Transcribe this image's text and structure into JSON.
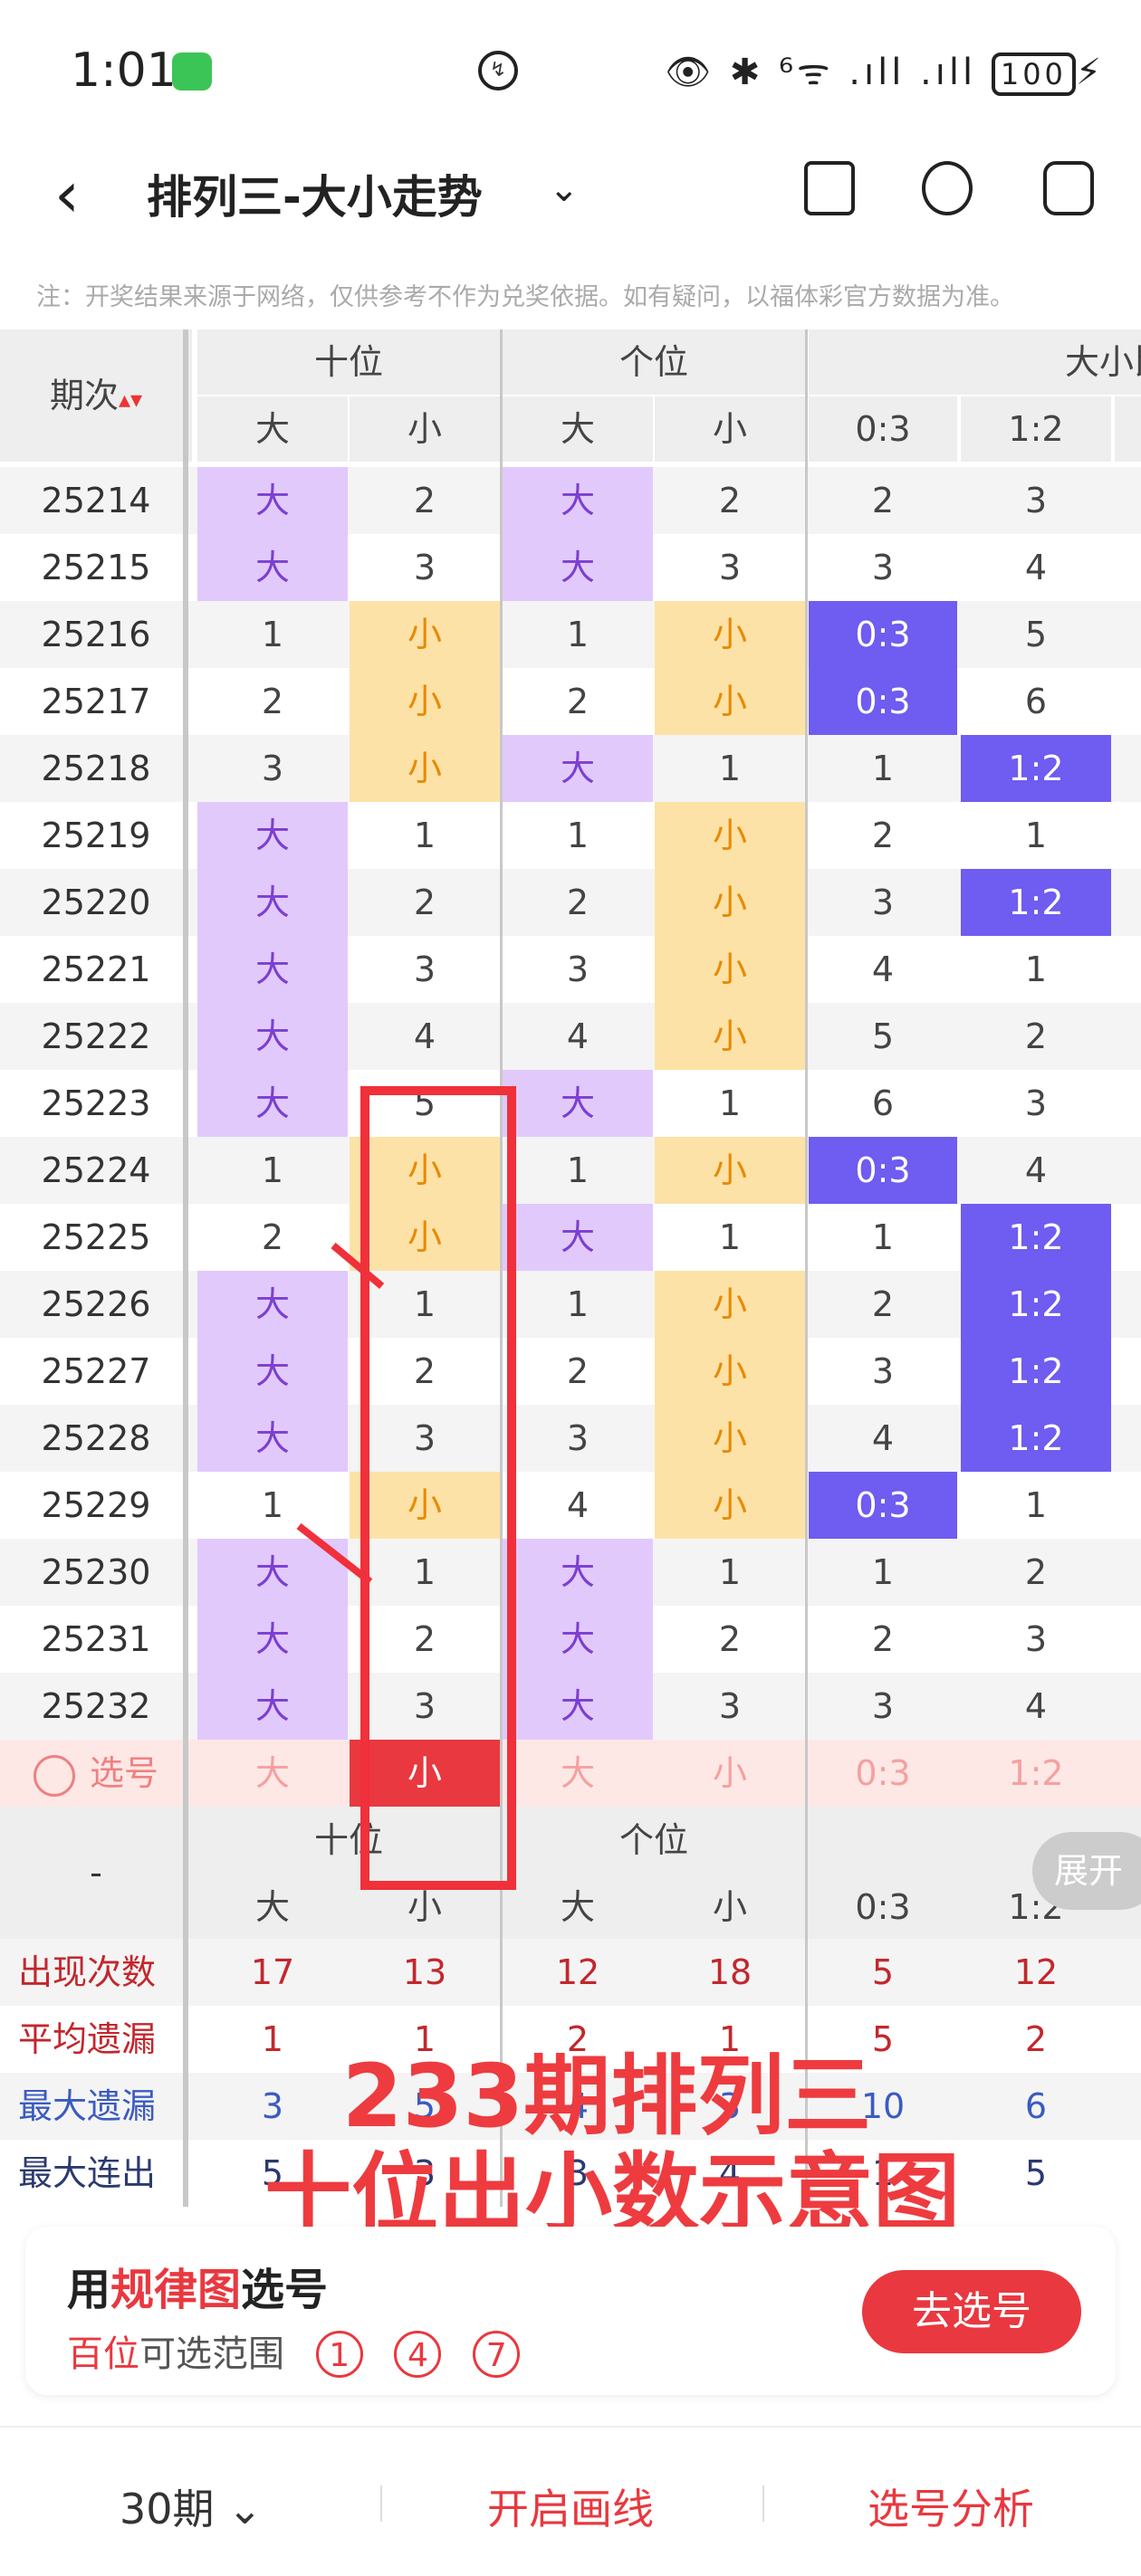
{
  "status": {
    "time": "1:01",
    "battery": "100",
    "right_icons": "👁 ✱ ⁶ᯤ .ıll .ıll"
  },
  "header": {
    "title": "排列三-大小走势",
    "back": "‹",
    "dropdown": "⌄"
  },
  "note": "注：开奖结果来源于网络，仅供参考不作为兑奖依据。如有疑问，以福体彩官方数据为准。",
  "table": {
    "period_label": "期次",
    "groups": [
      "十位",
      "个位",
      "大小比"
    ],
    "sub": [
      "大",
      "小",
      "大",
      "小",
      "0:3",
      "1:2"
    ],
    "rows": [
      {
        "p": "25214",
        "v": [
          "大",
          "2",
          "大",
          "2",
          "2",
          "3"
        ],
        "k": [
          "big",
          "",
          "big",
          "",
          "",
          ""
        ]
      },
      {
        "p": "25215",
        "v": [
          "大",
          "3",
          "大",
          "3",
          "3",
          "4"
        ],
        "k": [
          "big",
          "",
          "big",
          "",
          "",
          ""
        ]
      },
      {
        "p": "25216",
        "v": [
          "1",
          "小",
          "1",
          "小",
          "0:3",
          "5"
        ],
        "k": [
          "",
          "small",
          "",
          "small",
          "blue",
          ""
        ]
      },
      {
        "p": "25217",
        "v": [
          "2",
          "小",
          "2",
          "小",
          "0:3",
          "6"
        ],
        "k": [
          "",
          "small",
          "",
          "small",
          "blue",
          ""
        ]
      },
      {
        "p": "25218",
        "v": [
          "3",
          "小",
          "大",
          "1",
          "1",
          "1:2"
        ],
        "k": [
          "",
          "small",
          "big",
          "",
          "",
          "blue"
        ]
      },
      {
        "p": "25219",
        "v": [
          "大",
          "1",
          "1",
          "小",
          "2",
          "1"
        ],
        "k": [
          "big",
          "",
          "",
          "small",
          "",
          ""
        ]
      },
      {
        "p": "25220",
        "v": [
          "大",
          "2",
          "2",
          "小",
          "3",
          "1:2"
        ],
        "k": [
          "big",
          "",
          "",
          "small",
          "",
          "blue"
        ]
      },
      {
        "p": "25221",
        "v": [
          "大",
          "3",
          "3",
          "小",
          "4",
          "1"
        ],
        "k": [
          "big",
          "",
          "",
          "small",
          "",
          ""
        ]
      },
      {
        "p": "25222",
        "v": [
          "大",
          "4",
          "4",
          "小",
          "5",
          "2"
        ],
        "k": [
          "big",
          "",
          "",
          "small",
          "",
          ""
        ]
      },
      {
        "p": "25223",
        "v": [
          "大",
          "5",
          "大",
          "1",
          "6",
          "3"
        ],
        "k": [
          "big",
          "",
          "big",
          "",
          "",
          ""
        ]
      },
      {
        "p": "25224",
        "v": [
          "1",
          "小",
          "1",
          "小",
          "0:3",
          "4"
        ],
        "k": [
          "",
          "small",
          "",
          "small",
          "blue",
          ""
        ]
      },
      {
        "p": "25225",
        "v": [
          "2",
          "小",
          "大",
          "1",
          "1",
          "1:2"
        ],
        "k": [
          "",
          "small",
          "big",
          "",
          "",
          "blue"
        ]
      },
      {
        "p": "25226",
        "v": [
          "大",
          "1",
          "1",
          "小",
          "2",
          "1:2"
        ],
        "k": [
          "big",
          "",
          "",
          "small",
          "",
          "blue"
        ]
      },
      {
        "p": "25227",
        "v": [
          "大",
          "2",
          "2",
          "小",
          "3",
          "1:2"
        ],
        "k": [
          "big",
          "",
          "",
          "small",
          "",
          "blue"
        ]
      },
      {
        "p": "25228",
        "v": [
          "大",
          "3",
          "3",
          "小",
          "4",
          "1:2"
        ],
        "k": [
          "big",
          "",
          "",
          "small",
          "",
          "blue"
        ]
      },
      {
        "p": "25229",
        "v": [
          "1",
          "小",
          "4",
          "小",
          "0:3",
          "1"
        ],
        "k": [
          "",
          "small",
          "",
          "small",
          "blue",
          ""
        ]
      },
      {
        "p": "25230",
        "v": [
          "大",
          "1",
          "大",
          "1",
          "1",
          "2"
        ],
        "k": [
          "big",
          "",
          "big",
          "",
          "",
          ""
        ]
      },
      {
        "p": "25231",
        "v": [
          "大",
          "2",
          "大",
          "2",
          "2",
          "3"
        ],
        "k": [
          "big",
          "",
          "big",
          "",
          "",
          ""
        ]
      },
      {
        "p": "25232",
        "v": [
          "大",
          "3",
          "大",
          "3",
          "3",
          "4"
        ],
        "k": [
          "big",
          "",
          "big",
          "",
          "",
          ""
        ]
      }
    ],
    "select_row": {
      "label": "选号",
      "v": [
        "大",
        "小",
        "大",
        "小",
        "0:3",
        "1:2"
      ]
    },
    "footer_group_dash": "-"
  },
  "stats": [
    {
      "label": "出现次数",
      "v": [
        "17",
        "13",
        "12",
        "18",
        "5",
        "12"
      ],
      "color": "red"
    },
    {
      "label": "平均遗漏",
      "v": [
        "1",
        "1",
        "2",
        "1",
        "5",
        "2"
      ],
      "color": "red"
    },
    {
      "label": "最大遗漏",
      "v": [
        "3",
        "5",
        "4",
        "3",
        "10",
        "6"
      ],
      "color": "blue"
    },
    {
      "label": "最大连出",
      "v": [
        "5",
        "3",
        "3",
        "4",
        "1",
        "5"
      ],
      "color": "dark"
    }
  ],
  "overlay": {
    "line1": "233期排列三",
    "line2": "十位出小数示意图",
    "expand": "展开"
  },
  "card": {
    "pre": "用",
    "hl": "规律图",
    "post": "选号",
    "range_hl": "百位",
    "range": "可选范围",
    "nums": [
      "1",
      "4",
      "7"
    ],
    "button": "去选号"
  },
  "footer": {
    "period": "30期 ⌄",
    "draw": "开启画线",
    "analysis": "选号分析"
  }
}
